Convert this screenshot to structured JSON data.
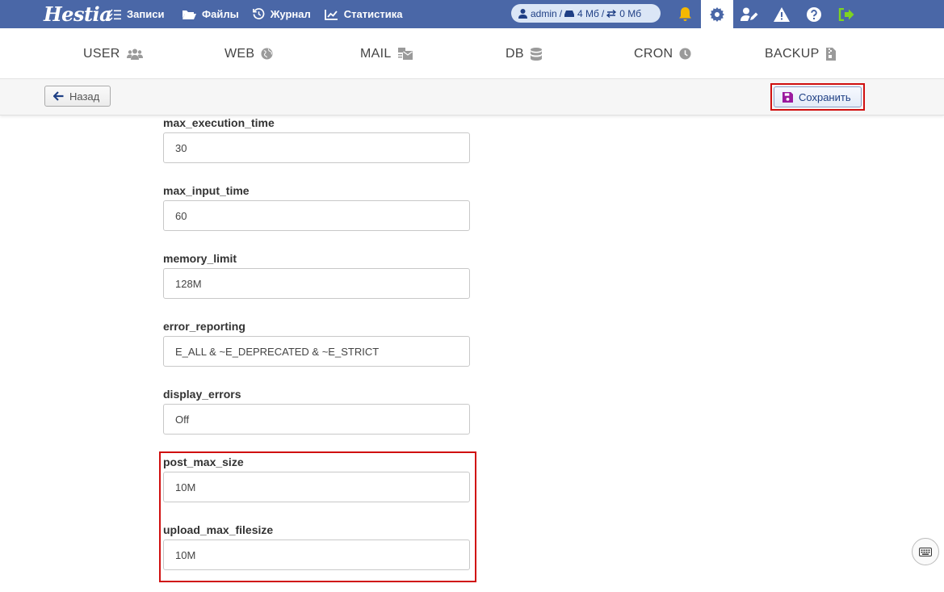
{
  "app": {
    "logo": "Hestia"
  },
  "topnav": [
    {
      "label": "Записи",
      "icon": "list-check-icon"
    },
    {
      "label": "Файлы",
      "icon": "folder-open-icon"
    },
    {
      "label": "Журнал",
      "icon": "history-icon"
    },
    {
      "label": "Статистика",
      "icon": "chart-line-icon"
    }
  ],
  "user": {
    "name": "admin",
    "sep": "/",
    "disk": "4 Мб",
    "sep2": "/",
    "bandwidth": "0 Мб"
  },
  "tabs": [
    {
      "label": "USER",
      "icon": "users-icon"
    },
    {
      "label": "WEB",
      "icon": "globe-icon"
    },
    {
      "label": "MAIL",
      "icon": "mail-bulk-icon"
    },
    {
      "label": "DB",
      "icon": "database-icon"
    },
    {
      "label": "CRON",
      "icon": "clock-icon"
    },
    {
      "label": "BACKUP",
      "icon": "file-archive-icon"
    }
  ],
  "toolbar": {
    "back_label": "Назад",
    "save_label": "Сохранить"
  },
  "fields": [
    {
      "label": "max_execution_time",
      "value": "30"
    },
    {
      "label": "max_input_time",
      "value": "60"
    },
    {
      "label": "memory_limit",
      "value": "128M"
    },
    {
      "label": "error_reporting",
      "value": "E_ALL & ~E_DEPRECATED & ~E_STRICT"
    },
    {
      "label": "display_errors",
      "value": "Off"
    },
    {
      "label": "post_max_size",
      "value": "10M"
    },
    {
      "label": "upload_max_filesize",
      "value": "10M"
    }
  ],
  "colors": {
    "topbar": "#4a67a7",
    "bell": "#f5b800",
    "logout": "#7ed321",
    "highlight": "#d01010",
    "save_icon": "#9b1a9e"
  }
}
